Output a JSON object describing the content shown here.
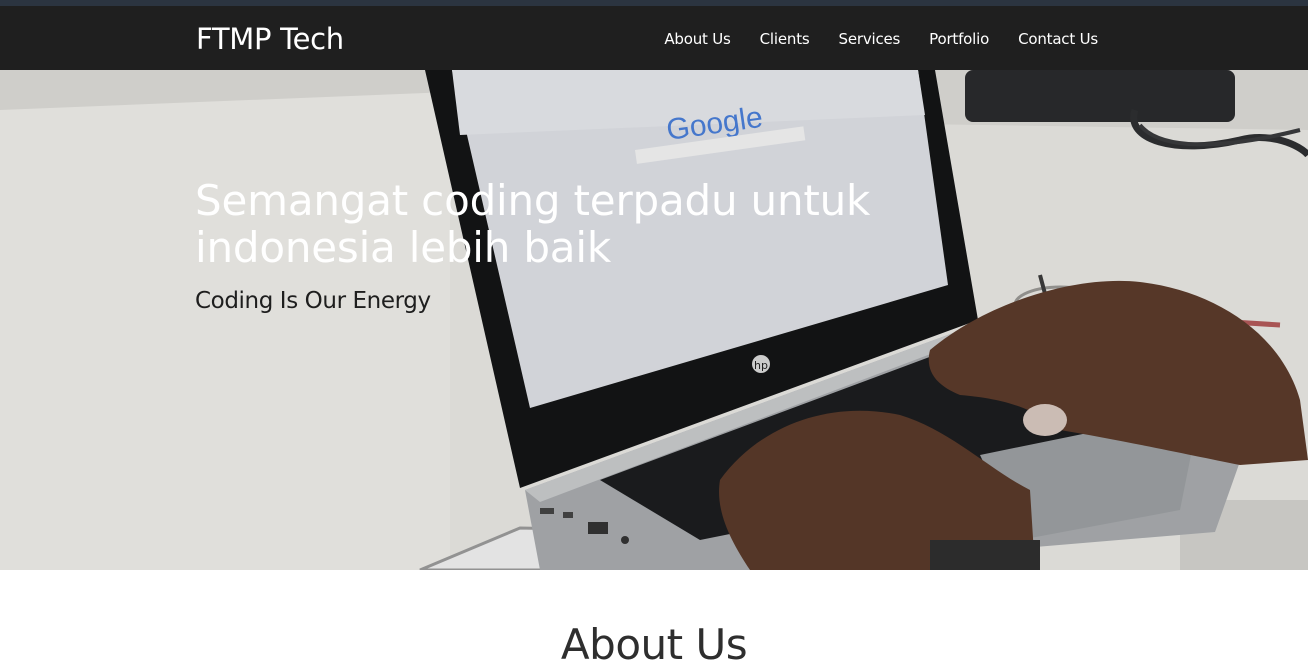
{
  "navbar": {
    "brand": "FTMP Tech",
    "links": [
      "About Us",
      "Clients",
      "Services",
      "Portfolio",
      "Contact Us"
    ]
  },
  "hero": {
    "title": "Semangat coding terpadu untuk indonesia lebih baik",
    "subtitle": "Coding Is Our Energy",
    "image": {
      "screen_logo": "Google",
      "laptop_badge": "hp"
    }
  },
  "about": {
    "title": "About Us"
  },
  "colors": {
    "navbar_bg": "#1f1f1f",
    "top_strip": "#2b3440",
    "hero_title": "#ffffff",
    "hero_subtitle": "#1e1e1e"
  }
}
